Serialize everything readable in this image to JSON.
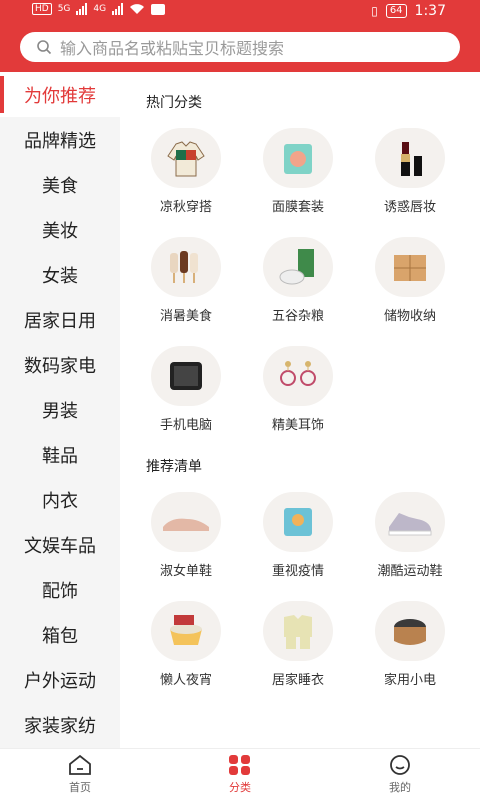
{
  "status": {
    "carrier_left": "HD",
    "net1": "5G",
    "net2": "4G",
    "battery": "64",
    "time": "1:37"
  },
  "search": {
    "placeholder": "输入商品名或粘贴宝贝标题搜索"
  },
  "sidebar": {
    "items": [
      {
        "label": "为你推荐",
        "active": true
      },
      {
        "label": "品牌精选"
      },
      {
        "label": "美食"
      },
      {
        "label": "美妆"
      },
      {
        "label": "女装"
      },
      {
        "label": "居家日用"
      },
      {
        "label": "数码家电"
      },
      {
        "label": "男装"
      },
      {
        "label": "鞋品"
      },
      {
        "label": "内衣"
      },
      {
        "label": "文娱车品"
      },
      {
        "label": "配饰"
      },
      {
        "label": "箱包"
      },
      {
        "label": "户外运动"
      },
      {
        "label": "家装家纺"
      }
    ]
  },
  "sections": [
    {
      "title": "热门分类",
      "items": [
        {
          "label": "凉秋穿搭",
          "icon": "jacket-icon"
        },
        {
          "label": "面膜套装",
          "icon": "facemask-icon"
        },
        {
          "label": "诱惑唇妆",
          "icon": "lipstick-icon"
        },
        {
          "label": "消暑美食",
          "icon": "popsicle-icon"
        },
        {
          "label": "五谷杂粮",
          "icon": "rice-icon"
        },
        {
          "label": "储物收纳",
          "icon": "drawer-icon"
        },
        {
          "label": "手机电脑",
          "icon": "phone-icon"
        },
        {
          "label": "精美耳饰",
          "icon": "earring-icon"
        }
      ]
    },
    {
      "title": "推荐清单",
      "items": [
        {
          "label": "淑女单鞋",
          "icon": "flat-shoe-icon"
        },
        {
          "label": "重视疫情",
          "icon": "medical-mask-icon"
        },
        {
          "label": "潮酷运动鞋",
          "icon": "sneaker-icon"
        },
        {
          "label": "懒人夜宵",
          "icon": "instant-noodle-icon"
        },
        {
          "label": "居家睡衣",
          "icon": "pajamas-icon"
        },
        {
          "label": "家用小电",
          "icon": "rice-cooker-icon"
        }
      ]
    }
  ],
  "tabbar": {
    "tabs": [
      {
        "label": "首页",
        "icon": "home-icon"
      },
      {
        "label": "分类",
        "icon": "category-icon",
        "active": true
      },
      {
        "label": "我的",
        "icon": "profile-icon"
      }
    ]
  },
  "colors": {
    "accent": "#e23a3a"
  }
}
